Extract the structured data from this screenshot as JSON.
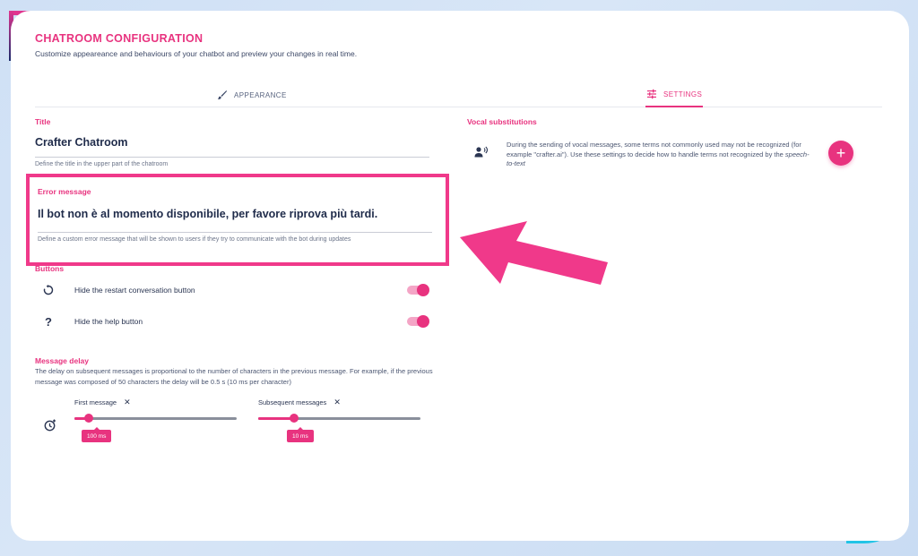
{
  "header": {
    "title": "CHATROOM CONFIGURATION",
    "subtitle": "Customize appeareance and behaviours of your chatbot and preview your changes in real time."
  },
  "tabs": [
    {
      "label": "APPEARANCE",
      "icon": "brush-icon",
      "active": false
    },
    {
      "label": "SETTINGS",
      "icon": "sliders-icon",
      "active": true
    }
  ],
  "title_field": {
    "label": "Title",
    "value": "Crafter Chatroom",
    "hint": "Define the title in the upper part of the chatroom"
  },
  "error_field": {
    "label": "Error message",
    "value": "Il bot non è al momento disponibile, per favore riprova più tardi.",
    "hint": "Define a custom error message that will be shown to users if they try to communicate with the bot during updates"
  },
  "buttons_section": {
    "label": "Buttons",
    "items": [
      {
        "label": "Hide the restart conversation button",
        "icon": "restart-icon",
        "enabled": true
      },
      {
        "label": "Hide the help button",
        "icon": "help-icon",
        "enabled": true
      }
    ]
  },
  "message_delay": {
    "label": "Message delay",
    "description": "The delay on subsequent messages is proportional to the number of characters in the previous message. For example, if the previous message was composed of 50 characters the delay will be 0.5 s (10 ms per character)",
    "sliders": [
      {
        "label": "First message",
        "value_text": "100 ms",
        "fraction": 0.09
      },
      {
        "label": "Subsequent messages",
        "value_text": "10 ms",
        "fraction": 0.22
      }
    ]
  },
  "vocal": {
    "label": "Vocal substitutions",
    "description_pre": "During the sending of vocal messages, some terms not commonly used may not be recognized (for example \"crafter.ai\"). Use these settings to decide how to handle terms not recognized by the ",
    "description_em": "speech-to-text",
    "add_label": "+"
  },
  "colors": {
    "accent": "#e8337f",
    "text": "#2a3552",
    "highlight_border": "#f0398a"
  }
}
